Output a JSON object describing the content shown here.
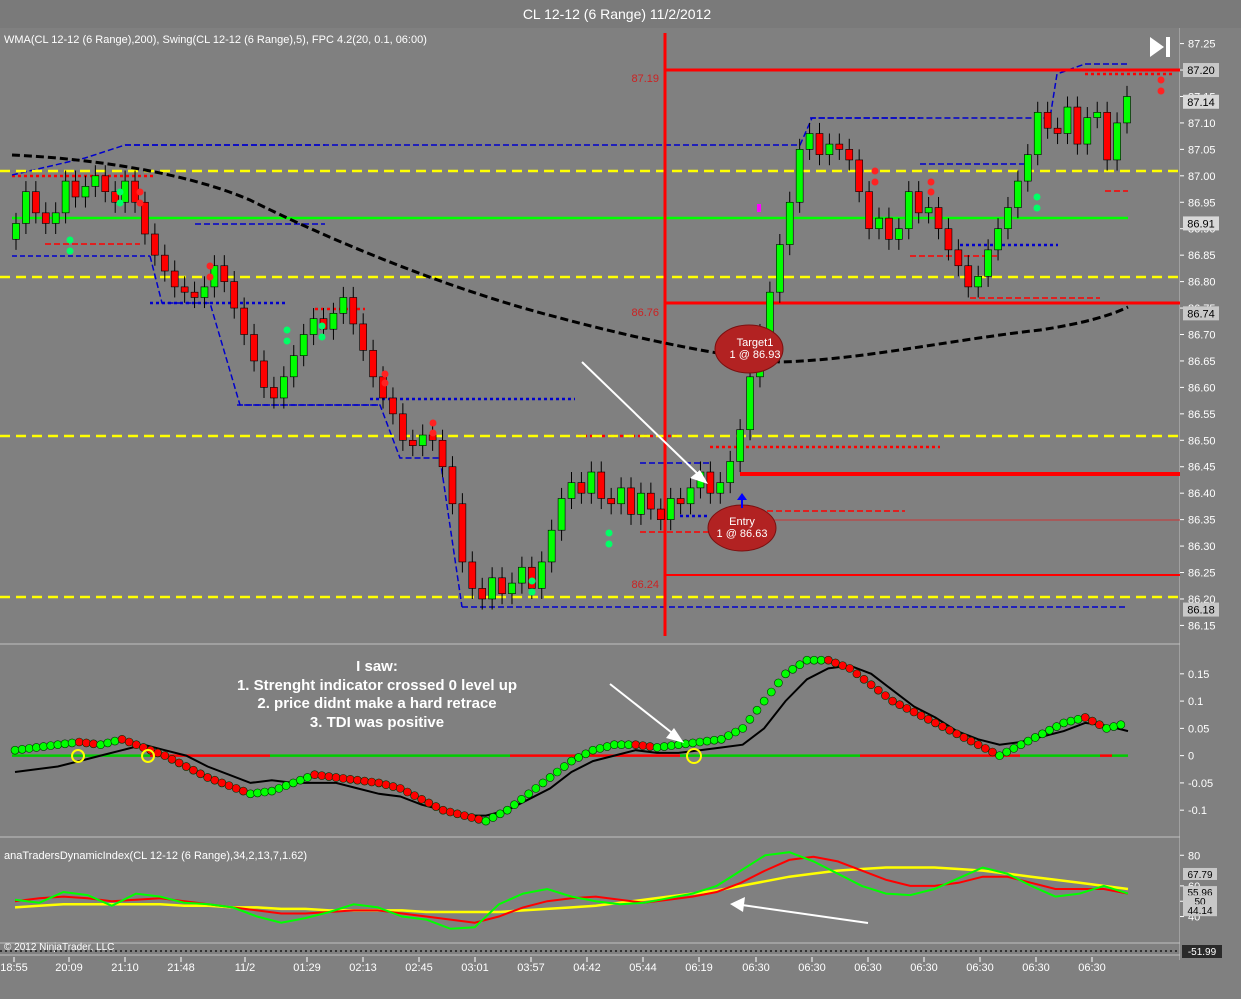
{
  "window_title": "CL 12-12 (6 Range)  11/2/2012",
  "price_panel": {
    "indicator_label": "WMA(CL 12-12 (6 Range),200), Swing(CL 12-12 (6 Range),5), FPC 4.2(20, 0.1, 06:00)",
    "y_ticks": [
      "87.25",
      "87.20",
      "87.15",
      "87.10",
      "87.05",
      "87.00",
      "86.95",
      "86.90",
      "86.85",
      "86.80",
      "86.75",
      "86.70",
      "86.65",
      "86.60",
      "86.55",
      "86.50",
      "86.45",
      "86.40",
      "86.35",
      "86.30",
      "86.25",
      "86.20",
      "86.15"
    ],
    "price_badges": [
      "87.20",
      "87.14",
      "86.91",
      "86.74",
      "86.18"
    ],
    "level_labels": [
      "87.19",
      "86.76",
      "86.24"
    ],
    "target_bubble": {
      "line1": "Target1",
      "line2": "1 @ 86.93"
    },
    "entry_bubble": {
      "line1": "Entry",
      "line2": "1 @ 86.63"
    }
  },
  "strength_panel": {
    "y_ticks": [
      "0.15",
      "0.1",
      "0.05",
      "0",
      "-0.05",
      "-0.1"
    ],
    "notes": [
      "I saw:",
      "1. Strenght indicator crossed 0 level up",
      "2. price didnt make a hard retrace",
      "3. TDI was positive"
    ]
  },
  "tdi_panel": {
    "indicator_label": "anaTradersDynamicIndex(CL 12-12 (6 Range),34,2,13,7,1.62)",
    "y_ticks": [
      "80",
      "60",
      "50",
      "40"
    ],
    "badges": [
      "67.79",
      "55.96",
      "50",
      "44.14"
    ]
  },
  "bottom_strip": {
    "badge": "-51.99"
  },
  "copyright": "© 2012 NinjaTrader, LLC",
  "x_axis": {
    "ticks": [
      "18:55",
      "20:09",
      "21:10",
      "21:48",
      "11/2",
      "01:29",
      "02:13",
      "02:45",
      "03:01",
      "03:57",
      "04:42",
      "05:44",
      "06:19",
      "06:30",
      "06:30",
      "06:30",
      "06:30",
      "06:30",
      "06:30",
      "06:30"
    ]
  },
  "colors": {
    "background": "#808080",
    "up_candle": "#00ff00",
    "down_candle": "#ff0000",
    "level_line": "#ff0000",
    "support_line": "#ffff00",
    "wma": "#000000",
    "swing": "#0000cc"
  },
  "chart_data": [
    {
      "type": "candlestick",
      "title": "CL 12-12 (6 Range)  11/2/2012",
      "ylim": [
        86.13,
        87.27
      ],
      "closes": [
        86.91,
        86.97,
        86.93,
        86.91,
        86.93,
        86.99,
        86.96,
        86.98,
        87.0,
        86.97,
        86.95,
        86.99,
        86.95,
        86.89,
        86.85,
        86.82,
        86.79,
        86.78,
        86.77,
        86.79,
        86.83,
        86.8,
        86.75,
        86.7,
        86.65,
        86.6,
        86.58,
        86.62,
        86.66,
        86.7,
        86.73,
        86.71,
        86.74,
        86.77,
        86.72,
        86.67,
        86.62,
        86.58,
        86.55,
        86.5,
        86.49,
        86.51,
        86.5,
        86.45,
        86.38,
        86.27,
        86.22,
        86.2,
        86.24,
        86.21,
        86.23,
        86.26,
        86.22,
        86.27,
        86.33,
        86.39,
        86.42,
        86.4,
        86.44,
        86.39,
        86.38,
        86.41,
        86.36,
        86.4,
        86.37,
        86.35,
        86.39,
        86.38,
        86.41,
        86.44,
        86.4,
        86.42,
        86.46,
        86.52,
        86.62,
        86.7,
        86.78,
        86.87,
        86.95,
        87.05,
        87.08,
        87.04,
        87.06,
        87.05,
        87.03,
        86.97,
        86.9,
        86.92,
        86.88,
        86.9,
        86.97,
        86.93,
        86.94,
        86.9,
        86.86,
        86.83,
        86.79,
        86.81,
        86.86,
        86.9,
        86.94,
        86.99,
        87.04,
        87.12,
        87.09,
        87.08,
        87.13,
        87.06,
        87.11,
        87.12,
        87.03,
        87.1,
        87.15
      ]
    },
    {
      "type": "line",
      "series": [
        {
          "values": [
            0.01,
            0.015,
            0.02,
            0.025,
            0.02,
            0.03,
            0.015,
            0.0,
            -0.02,
            -0.04,
            -0.055,
            -0.07,
            -0.065,
            -0.05,
            -0.035,
            -0.04,
            -0.045,
            -0.05,
            -0.06,
            -0.08,
            -0.1,
            -0.11,
            -0.12,
            -0.1,
            -0.07,
            -0.04,
            -0.01,
            0.01,
            0.02,
            0.02,
            0.015,
            0.02,
            0.025,
            0.03,
            0.05,
            0.1,
            0.15,
            0.175,
            0.175,
            0.16,
            0.13,
            0.1,
            0.08,
            0.06,
            0.04,
            0.02,
            0.0,
            0.02,
            0.04,
            0.06,
            0.07,
            0.05,
            0.06
          ]
        },
        {
          "values": [
            -0.03,
            -0.025,
            -0.02,
            -0.01,
            0.0,
            0.01,
            0.02,
            0.01,
            0.0,
            -0.02,
            -0.035,
            -0.05,
            -0.045,
            -0.05,
            -0.05,
            -0.05,
            -0.06,
            -0.07,
            -0.075,
            -0.09,
            -0.1,
            -0.11,
            -0.11,
            -0.1,
            -0.08,
            -0.06,
            -0.03,
            -0.01,
            0.0,
            0.01,
            0.005,
            0.005,
            0.01,
            0.015,
            0.02,
            0.05,
            0.1,
            0.14,
            0.16,
            0.165,
            0.15,
            0.12,
            0.09,
            0.07,
            0.045,
            0.03,
            0.02,
            0.025,
            0.035,
            0.045,
            0.06,
            0.055,
            0.045
          ]
        }
      ],
      "ylim": [
        -0.14,
        0.19
      ]
    },
    {
      "type": "line",
      "series": [
        {
          "values": [
            51,
            49,
            56,
            54,
            47,
            55,
            53,
            49,
            48,
            46,
            40,
            36,
            39,
            43,
            48,
            46,
            40,
            38,
            32,
            33,
            48,
            55,
            58,
            53,
            50,
            48,
            49,
            52,
            55,
            60,
            70,
            80,
            82,
            76,
            68,
            60,
            55,
            54,
            58,
            65,
            72,
            68,
            60,
            53,
            55,
            60,
            55
          ]
        },
        {
          "values": [
            50,
            52,
            53,
            52,
            50,
            51,
            52,
            50,
            48,
            46,
            44,
            42,
            42,
            43,
            44,
            44,
            42,
            40,
            38,
            36,
            40,
            46,
            50,
            52,
            53,
            51,
            49,
            51,
            53,
            56,
            62,
            70,
            77,
            79,
            76,
            70,
            64,
            60,
            60,
            62,
            66,
            66,
            62,
            58,
            58,
            58,
            55
          ]
        },
        {
          "values": [
            46,
            47,
            48,
            48,
            48,
            48,
            48,
            47,
            47,
            46,
            46,
            45,
            45,
            44,
            44,
            44,
            44,
            43,
            43,
            43,
            43,
            44,
            45,
            46,
            47,
            49,
            51,
            53,
            55,
            57,
            60,
            63,
            66,
            68,
            70,
            71,
            72,
            72,
            72,
            71,
            70,
            68,
            66,
            64,
            62,
            60,
            58
          ]
        }
      ],
      "ylim": [
        26,
        88
      ]
    }
  ]
}
